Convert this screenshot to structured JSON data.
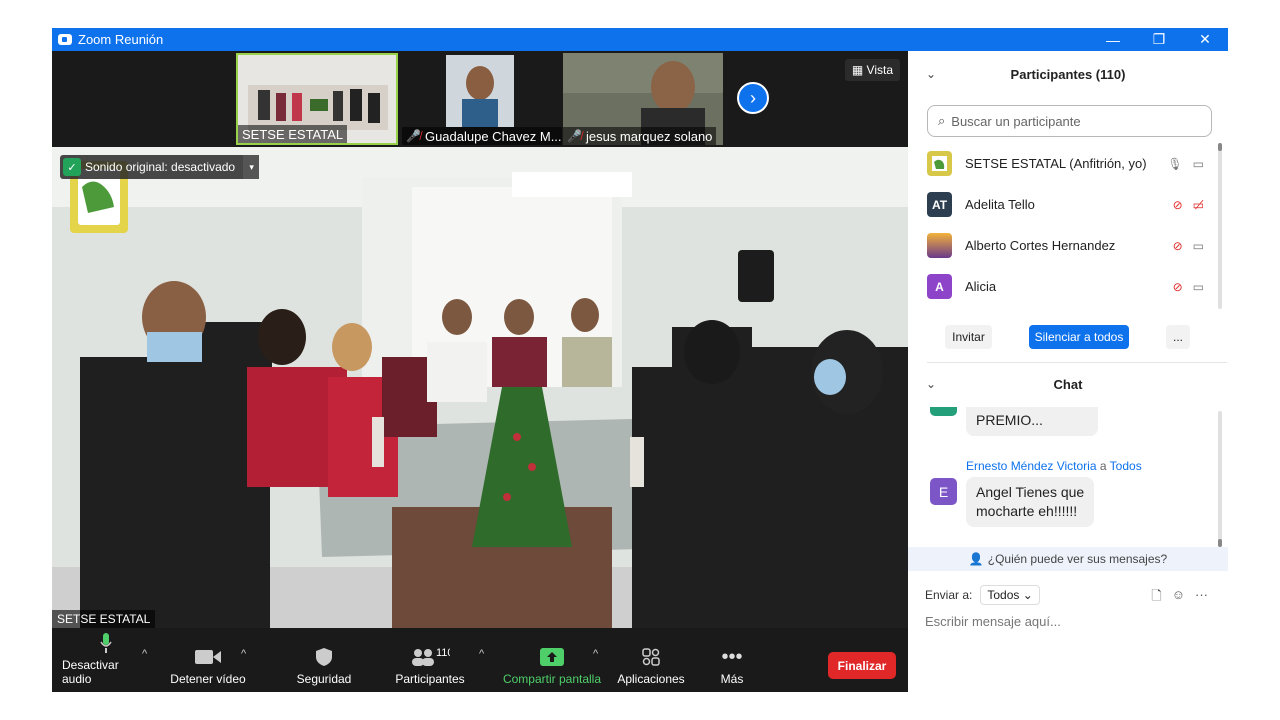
{
  "window": {
    "title": "Zoom Reunión",
    "controls": [
      "—",
      "❐",
      "✕"
    ]
  },
  "strip": {
    "thumbnails": [
      {
        "name": "SETSE ESTATAL",
        "muted": false
      },
      {
        "name": "Guadalupe Chavez M...",
        "muted": true
      },
      {
        "name": "jesus marquez solano",
        "muted": true
      }
    ],
    "view_label": "Vista"
  },
  "main_video": {
    "audio_badge": "Sonido original: desactivado",
    "speaker_name": "SETSE ESTATAL"
  },
  "toolbar": {
    "items": [
      {
        "label": "Desactivar audio",
        "icon": "microphone-icon"
      },
      {
        "label": "Detener vídeo",
        "icon": "video-camera-icon"
      },
      {
        "label": "Seguridad",
        "icon": "shield-icon"
      },
      {
        "label": "Participantes",
        "icon": "participants-icon",
        "badge": "110"
      },
      {
        "label": "Compartir pantalla",
        "icon": "share-screen-icon"
      },
      {
        "label": "Aplicaciones",
        "icon": "apps-icon"
      },
      {
        "label": "Más",
        "icon": "more-icon"
      }
    ],
    "end_label": "Finalizar"
  },
  "participants": {
    "header": "Participantes (110)",
    "search_placeholder": "Buscar un participante",
    "list": [
      {
        "name": "SETSE ESTATAL (Anfitrión, yo)",
        "initials": "",
        "color": "#d8c84a"
      },
      {
        "name": "Adelita Tello",
        "initials": "AT",
        "color": "#2d3e50"
      },
      {
        "name": "Alberto Cortes Hernandez",
        "initials": "",
        "color": "#6a3a8a"
      },
      {
        "name": "Alicia",
        "initials": "A",
        "color": "#8e44c8"
      }
    ],
    "invite_label": "Invitar",
    "mute_all_label": "Silenciar a todos",
    "more_label": "..."
  },
  "chat": {
    "header": "Chat",
    "partial_message": "PREMIO...",
    "sender": "Ernesto Méndez Victoria",
    "to_word": "a",
    "recipient": "Todos",
    "sender_initial": "E",
    "message_line1": "Angel Tienes que",
    "message_line2": "mocharte eh!!!!!!",
    "who_can_see": "¿Quién puede ver sus mensajes?",
    "send_to_label": "Enviar a:",
    "send_to_value": "Todos",
    "input_placeholder": "Escribir mensaje aquí..."
  }
}
